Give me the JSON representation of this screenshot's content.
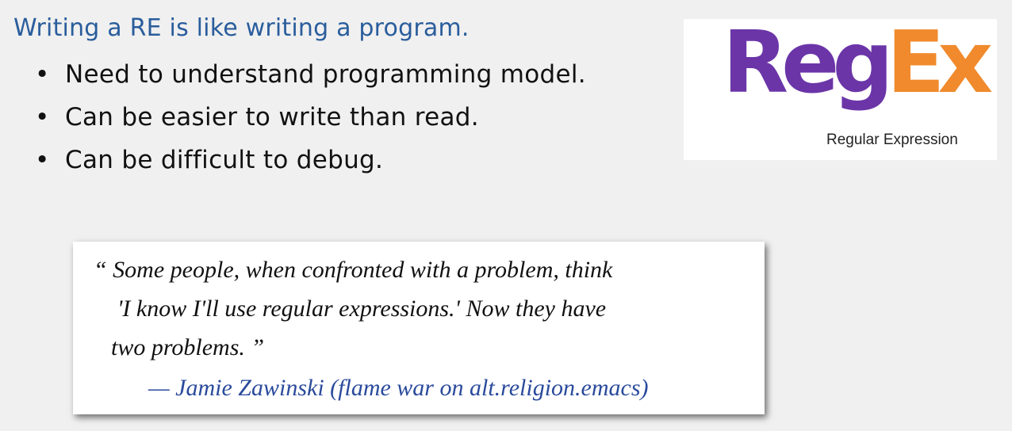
{
  "heading": "Writing a RE is like writing a program.",
  "bullets": [
    "Need to understand programming model.",
    "Can be easier to write than read.",
    "Can be difficult to debug."
  ],
  "bullet_symbol": "•",
  "logo": {
    "word_part1": "Reg",
    "word_part2": "Ex",
    "subtitle": "Regular Expression",
    "colors": {
      "reg": "#6b35a8",
      "ex": "#f08a2c"
    }
  },
  "quote": {
    "line1": "“ Some people, when confronted with a problem, think",
    "line2": "'I know I'll use regular expressions.'  Now they have",
    "line3": "two problems. ”",
    "attribution": "— Jamie Zawinski  (flame war on alt.religion.emacs)"
  },
  "colors": {
    "heading": "#2a5d9c",
    "attribution": "#2a4a9c",
    "background": "#f0f0f0"
  }
}
